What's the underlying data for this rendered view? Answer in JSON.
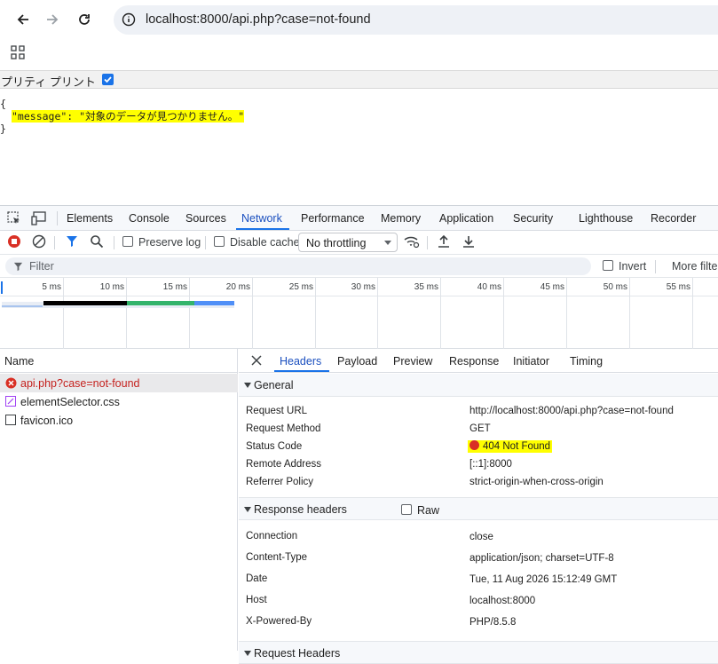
{
  "browser": {
    "url": "localhost:8000/api.php?case=not-found"
  },
  "page": {
    "pretty_print_label": "プリティ プリント",
    "json_open": "{",
    "json_line": "\"message\": \"対象のデータが見つかりません。\"",
    "json_close": "}"
  },
  "devtools": {
    "tabs": [
      "Elements",
      "Console",
      "Sources",
      "Network",
      "Performance",
      "Memory",
      "Application",
      "Security",
      "Lighthouse",
      "Recorder"
    ],
    "active_tab": "Network",
    "toolbar": {
      "preserve_log": "Preserve log",
      "disable_cache": "Disable cache",
      "throttling": "No throttling"
    },
    "filter": {
      "placeholder": "Filter",
      "invert": "Invert",
      "more_filters": "More filte"
    },
    "timeline_ticks": [
      "5 ms",
      "10 ms",
      "15 ms",
      "20 ms",
      "25 ms",
      "30 ms",
      "35 ms",
      "40 ms",
      "45 ms",
      "50 ms",
      "55 ms"
    ],
    "name_header": "Name",
    "requests": [
      {
        "name": "api.php?case=not-found",
        "status": "error"
      },
      {
        "name": "elementSelector.css",
        "status": "ok"
      },
      {
        "name": "favicon.ico",
        "status": "ok"
      }
    ],
    "detail_tabs": [
      "Headers",
      "Payload",
      "Preview",
      "Response",
      "Initiator",
      "Timing"
    ],
    "active_detail_tab": "Headers",
    "general": {
      "title": "General",
      "rows": [
        {
          "k": "Request URL",
          "v": "http://localhost:8000/api.php?case=not-found"
        },
        {
          "k": "Request Method",
          "v": "GET"
        },
        {
          "k": "Status Code",
          "v": "404 Not Found"
        },
        {
          "k": "Remote Address",
          "v": "[::1]:8000"
        },
        {
          "k": "Referrer Policy",
          "v": "strict-origin-when-cross-origin"
        }
      ]
    },
    "response_headers": {
      "title": "Response headers",
      "raw_label": "Raw",
      "rows": [
        {
          "k": "Connection",
          "v": "close"
        },
        {
          "k": "Content-Type",
          "v": "application/json; charset=UTF-8"
        },
        {
          "k": "Date",
          "v": "Tue, 11 Aug 2026 15:12:49 GMT"
        },
        {
          "k": "Host",
          "v": "localhost:8000"
        },
        {
          "k": "X-Powered-By",
          "v": "PHP/8.5.8"
        }
      ]
    },
    "request_headers_title": "Request Headers"
  },
  "colors": {
    "accent": "#1a73e8",
    "error": "#d93025",
    "highlight": "#ffff00"
  }
}
